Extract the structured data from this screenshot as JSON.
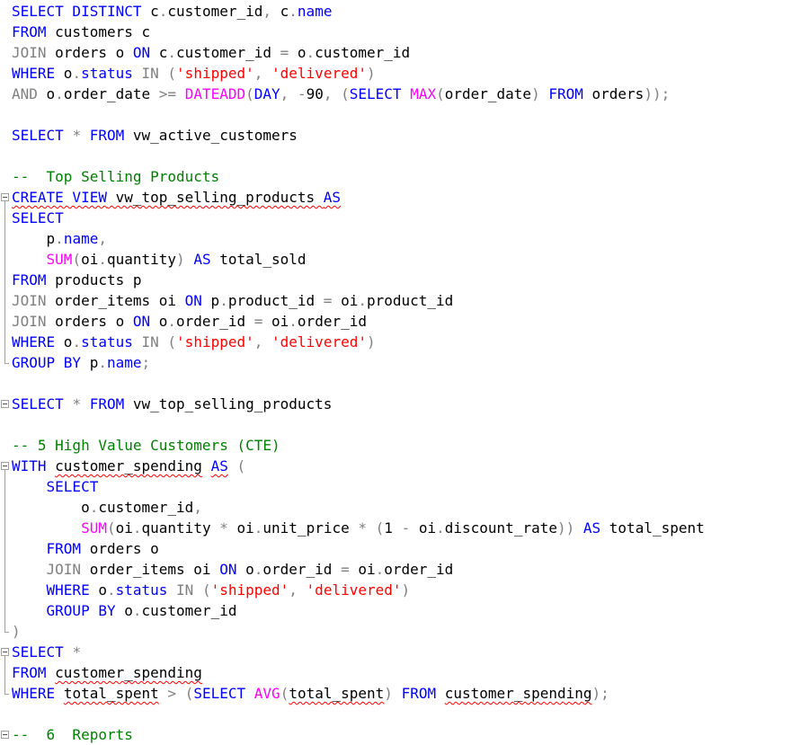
{
  "editor": {
    "lines": [
      [
        [
          "kw",
          "SELECT DISTINCT"
        ],
        [
          "id",
          " c"
        ],
        [
          "op",
          "."
        ],
        [
          "id",
          "customer_id"
        ],
        [
          "op",
          ","
        ],
        [
          "id",
          " c"
        ],
        [
          "op",
          "."
        ],
        [
          "kw",
          "name"
        ]
      ],
      [
        [
          "kw",
          "FROM"
        ],
        [
          "id",
          " customers c"
        ]
      ],
      [
        [
          "op",
          "JOIN"
        ],
        [
          "id",
          " orders o "
        ],
        [
          "kw",
          "ON"
        ],
        [
          "id",
          " c"
        ],
        [
          "op",
          "."
        ],
        [
          "id",
          "customer_id "
        ],
        [
          "op",
          "="
        ],
        [
          "id",
          " o"
        ],
        [
          "op",
          "."
        ],
        [
          "id",
          "customer_id"
        ]
      ],
      [
        [
          "kw",
          "WHERE"
        ],
        [
          "id",
          " o"
        ],
        [
          "op",
          "."
        ],
        [
          "kw",
          "status"
        ],
        [
          "op",
          " IN ("
        ],
        [
          "str",
          "'shipped'"
        ],
        [
          "op",
          ", "
        ],
        [
          "str",
          "'delivered'"
        ],
        [
          "op",
          ")"
        ]
      ],
      [
        [
          "op",
          "AND"
        ],
        [
          "id",
          " o"
        ],
        [
          "op",
          "."
        ],
        [
          "id",
          "order_date "
        ],
        [
          "op",
          ">= "
        ],
        [
          "fn",
          "DATEADD"
        ],
        [
          "op",
          "("
        ],
        [
          "kw",
          "DAY"
        ],
        [
          "op",
          ", "
        ],
        [
          "op",
          "-"
        ],
        [
          "id",
          "90"
        ],
        [
          "op",
          ", ("
        ],
        [
          "kw",
          "SELECT"
        ],
        [
          "id",
          " "
        ],
        [
          "fn",
          "MAX"
        ],
        [
          "op",
          "("
        ],
        [
          "id",
          "order_date"
        ],
        [
          "op",
          ")"
        ],
        [
          "id",
          " "
        ],
        [
          "kw",
          "FROM"
        ],
        [
          "id",
          " orders"
        ],
        [
          "op",
          "));"
        ]
      ],
      [],
      [
        [
          "kw",
          "SELECT"
        ],
        [
          "id",
          " "
        ],
        [
          "op",
          "*"
        ],
        [
          "id",
          " "
        ],
        [
          "kw",
          "FROM"
        ],
        [
          "id",
          " vw_active_customers"
        ]
      ],
      [],
      [
        [
          "cm",
          "--  Top Selling Products"
        ]
      ],
      [
        [
          "kw",
          "CREATE VIEW",
          "sq"
        ],
        [
          "id",
          " vw_top_selling_products",
          "sq"
        ],
        [
          "id",
          " ",
          "sq"
        ],
        [
          "kw",
          "AS",
          "sq"
        ]
      ],
      [
        [
          "kw",
          "SELECT"
        ]
      ],
      [
        [
          "id",
          "    p"
        ],
        [
          "op",
          "."
        ],
        [
          "kw",
          "name"
        ],
        [
          "op",
          ","
        ]
      ],
      [
        [
          "id",
          "    "
        ],
        [
          "fn",
          "SUM"
        ],
        [
          "op",
          "("
        ],
        [
          "id",
          "oi"
        ],
        [
          "op",
          "."
        ],
        [
          "id",
          "quantity"
        ],
        [
          "op",
          ")"
        ],
        [
          "id",
          " "
        ],
        [
          "kw",
          "AS"
        ],
        [
          "id",
          " total_sold"
        ]
      ],
      [
        [
          "kw",
          "FROM"
        ],
        [
          "id",
          " products p"
        ]
      ],
      [
        [
          "op",
          "JOIN"
        ],
        [
          "id",
          " order_items oi "
        ],
        [
          "kw",
          "ON"
        ],
        [
          "id",
          " p"
        ],
        [
          "op",
          "."
        ],
        [
          "id",
          "product_id "
        ],
        [
          "op",
          "="
        ],
        [
          "id",
          " oi"
        ],
        [
          "op",
          "."
        ],
        [
          "id",
          "product_id"
        ]
      ],
      [
        [
          "op",
          "JOIN"
        ],
        [
          "id",
          " orders o "
        ],
        [
          "kw",
          "ON"
        ],
        [
          "id",
          " o"
        ],
        [
          "op",
          "."
        ],
        [
          "id",
          "order_id "
        ],
        [
          "op",
          "="
        ],
        [
          "id",
          " oi"
        ],
        [
          "op",
          "."
        ],
        [
          "id",
          "order_id"
        ]
      ],
      [
        [
          "kw",
          "WHERE"
        ],
        [
          "id",
          " o"
        ],
        [
          "op",
          "."
        ],
        [
          "kw",
          "status"
        ],
        [
          "op",
          " IN ("
        ],
        [
          "str",
          "'shipped'"
        ],
        [
          "op",
          ", "
        ],
        [
          "str",
          "'delivered'"
        ],
        [
          "op",
          ")"
        ]
      ],
      [
        [
          "kw",
          "GROUP BY"
        ],
        [
          "id",
          " p"
        ],
        [
          "op",
          "."
        ],
        [
          "kw",
          "name"
        ],
        [
          "op",
          ";"
        ]
      ],
      [],
      [
        [
          "kw",
          "SELECT"
        ],
        [
          "id",
          " "
        ],
        [
          "op",
          "*"
        ],
        [
          "id",
          " "
        ],
        [
          "kw",
          "FROM"
        ],
        [
          "id",
          " vw_top_selling_products"
        ]
      ],
      [],
      [
        [
          "cm",
          "-- 5 High Value Customers (CTE)"
        ]
      ],
      [
        [
          "kw",
          "WITH"
        ],
        [
          "id",
          " "
        ],
        [
          "id",
          "customer_spending",
          "sq"
        ],
        [
          "id",
          " "
        ],
        [
          "kw",
          "AS",
          "sq"
        ],
        [
          "id",
          " "
        ],
        [
          "op",
          "("
        ]
      ],
      [
        [
          "id",
          "    "
        ],
        [
          "kw",
          "SELECT"
        ]
      ],
      [
        [
          "id",
          "        o"
        ],
        [
          "op",
          "."
        ],
        [
          "id",
          "customer_id"
        ],
        [
          "op",
          ","
        ]
      ],
      [
        [
          "id",
          "        "
        ],
        [
          "fn",
          "SUM"
        ],
        [
          "op",
          "("
        ],
        [
          "id",
          "oi"
        ],
        [
          "op",
          "."
        ],
        [
          "id",
          "quantity "
        ],
        [
          "op",
          "*"
        ],
        [
          "id",
          " oi"
        ],
        [
          "op",
          "."
        ],
        [
          "id",
          "unit_price "
        ],
        [
          "op",
          "*"
        ],
        [
          "id",
          " "
        ],
        [
          "op",
          "("
        ],
        [
          "id",
          "1 "
        ],
        [
          "op",
          "-"
        ],
        [
          "id",
          " oi"
        ],
        [
          "op",
          "."
        ],
        [
          "id",
          "discount_rate"
        ],
        [
          "op",
          "))"
        ],
        [
          "id",
          " "
        ],
        [
          "kw",
          "AS"
        ],
        [
          "id",
          " total_spent"
        ]
      ],
      [
        [
          "id",
          "    "
        ],
        [
          "kw",
          "FROM"
        ],
        [
          "id",
          " orders o"
        ]
      ],
      [
        [
          "id",
          "    "
        ],
        [
          "op",
          "JOIN"
        ],
        [
          "id",
          " order_items oi "
        ],
        [
          "kw",
          "ON"
        ],
        [
          "id",
          " o"
        ],
        [
          "op",
          "."
        ],
        [
          "id",
          "order_id "
        ],
        [
          "op",
          "="
        ],
        [
          "id",
          " oi"
        ],
        [
          "op",
          "."
        ],
        [
          "id",
          "order_id"
        ]
      ],
      [
        [
          "id",
          "    "
        ],
        [
          "kw",
          "WHERE"
        ],
        [
          "id",
          " o"
        ],
        [
          "op",
          "."
        ],
        [
          "kw",
          "status"
        ],
        [
          "op",
          " IN ("
        ],
        [
          "str",
          "'shipped'"
        ],
        [
          "op",
          ", "
        ],
        [
          "str",
          "'delivered'"
        ],
        [
          "op",
          ")"
        ]
      ],
      [
        [
          "id",
          "    "
        ],
        [
          "kw",
          "GROUP BY"
        ],
        [
          "id",
          " o"
        ],
        [
          "op",
          "."
        ],
        [
          "id",
          "customer_id"
        ]
      ],
      [
        [
          "op",
          ")"
        ]
      ],
      [
        [
          "kw",
          "SELECT"
        ],
        [
          "id",
          " "
        ],
        [
          "op",
          "*"
        ]
      ],
      [
        [
          "kw",
          "FROM"
        ],
        [
          "id",
          " "
        ],
        [
          "id",
          "customer_spending",
          "sq"
        ]
      ],
      [
        [
          "kw",
          "WHERE"
        ],
        [
          "id",
          " "
        ],
        [
          "id",
          "total_spent",
          "sq"
        ],
        [
          "id",
          " "
        ],
        [
          "op",
          ">"
        ],
        [
          "id",
          " "
        ],
        [
          "op",
          "("
        ],
        [
          "kw",
          "SELECT"
        ],
        [
          "id",
          " "
        ],
        [
          "fn",
          "AVG"
        ],
        [
          "op",
          "("
        ],
        [
          "id",
          "total_spent",
          "sq"
        ],
        [
          "op",
          ")"
        ],
        [
          "id",
          " "
        ],
        [
          "kw",
          "FROM"
        ],
        [
          "id",
          " "
        ],
        [
          "id",
          "customer_spending",
          "sq"
        ],
        [
          "op",
          ");"
        ]
      ],
      [],
      [
        [
          "cm",
          "--  6  Reports"
        ]
      ]
    ]
  }
}
